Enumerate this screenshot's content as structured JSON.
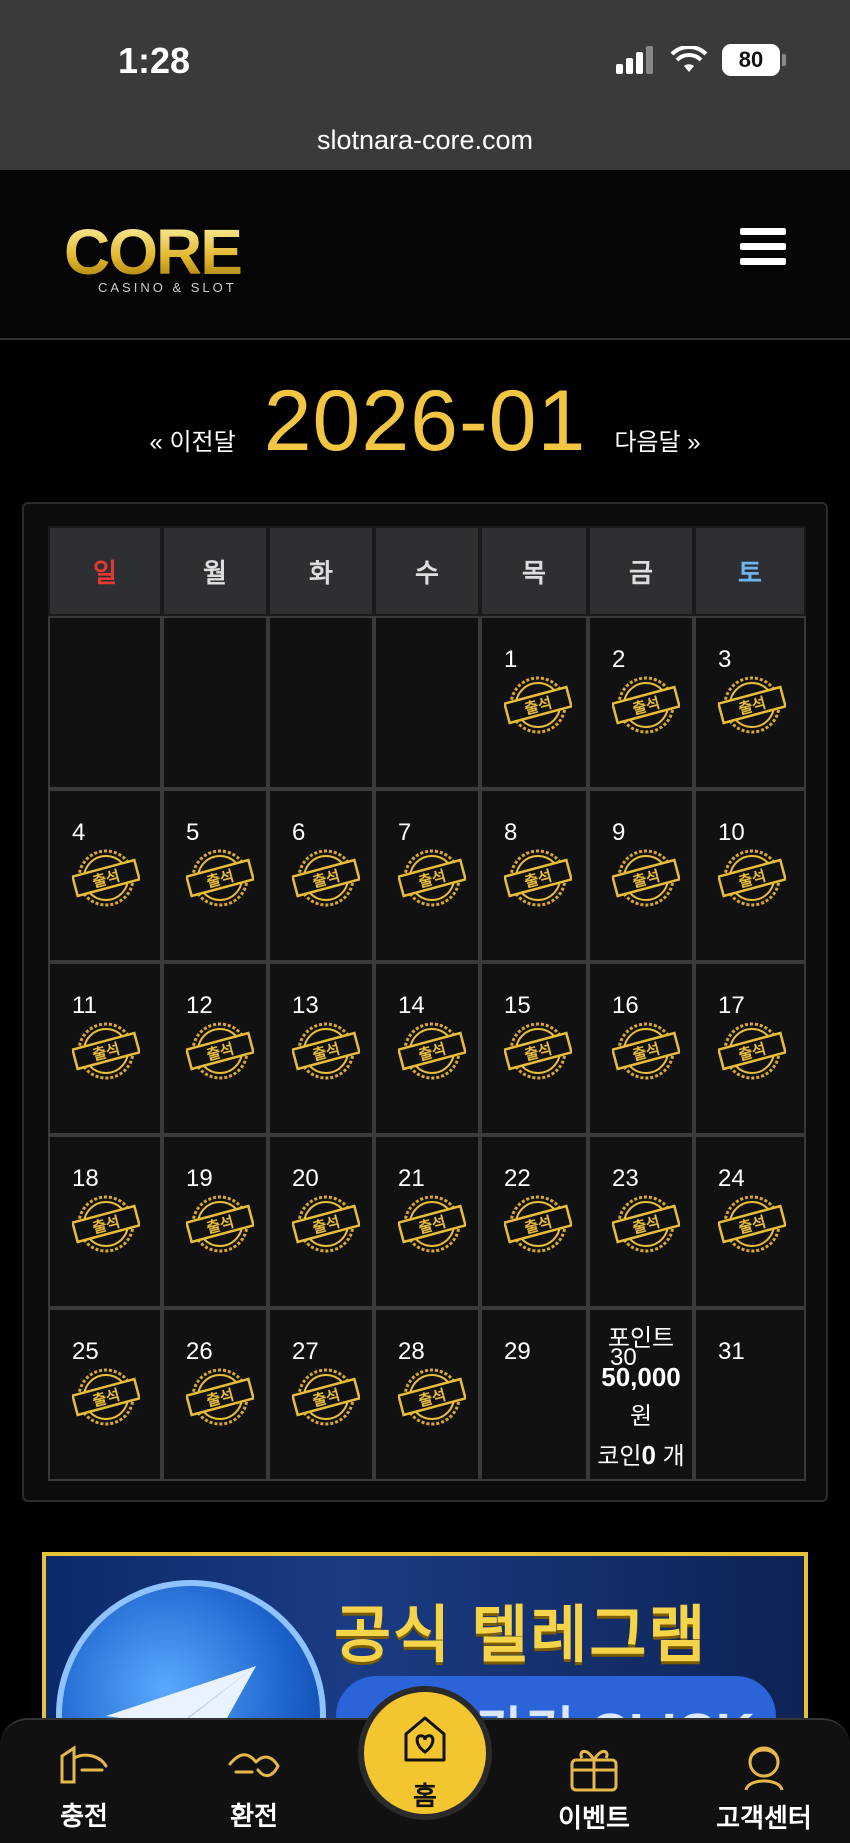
{
  "status_bar": {
    "time": "1:28",
    "battery": "80"
  },
  "browser": {
    "url": "slotnara-core.com"
  },
  "header": {
    "logo_text": "CORE",
    "logo_sub": "CASINO & SLOT"
  },
  "calendar": {
    "prev_label": "« 이전달",
    "next_label": "다음달 »",
    "month": "2026-01",
    "weekdays": [
      "일",
      "월",
      "화",
      "수",
      "목",
      "금",
      "토"
    ],
    "weekday_colors": [
      "#e53935",
      "#dddddd",
      "#dddddd",
      "#dddddd",
      "#dddddd",
      "#dddddd",
      "#6fb3f0"
    ],
    "first_weekday": 4,
    "days_in_month": 31,
    "attended_through": 28,
    "stamp_text": "출석",
    "bonus_day": 30,
    "bonus": {
      "line1": "포인트",
      "points": "50,000",
      "unit": "원",
      "coin_prefix": "코인",
      "coins": "0",
      "coin_unit": "개"
    }
  },
  "banner": {
    "title": "공식 텔레그램",
    "cta": "바로가기 CLICK"
  },
  "tabbar": {
    "charge": "충전",
    "exchange": "환전",
    "home": "홈",
    "event": "이벤트",
    "support": "고객센터"
  },
  "colors": {
    "gold": "#f2c543",
    "background": "#000000"
  }
}
